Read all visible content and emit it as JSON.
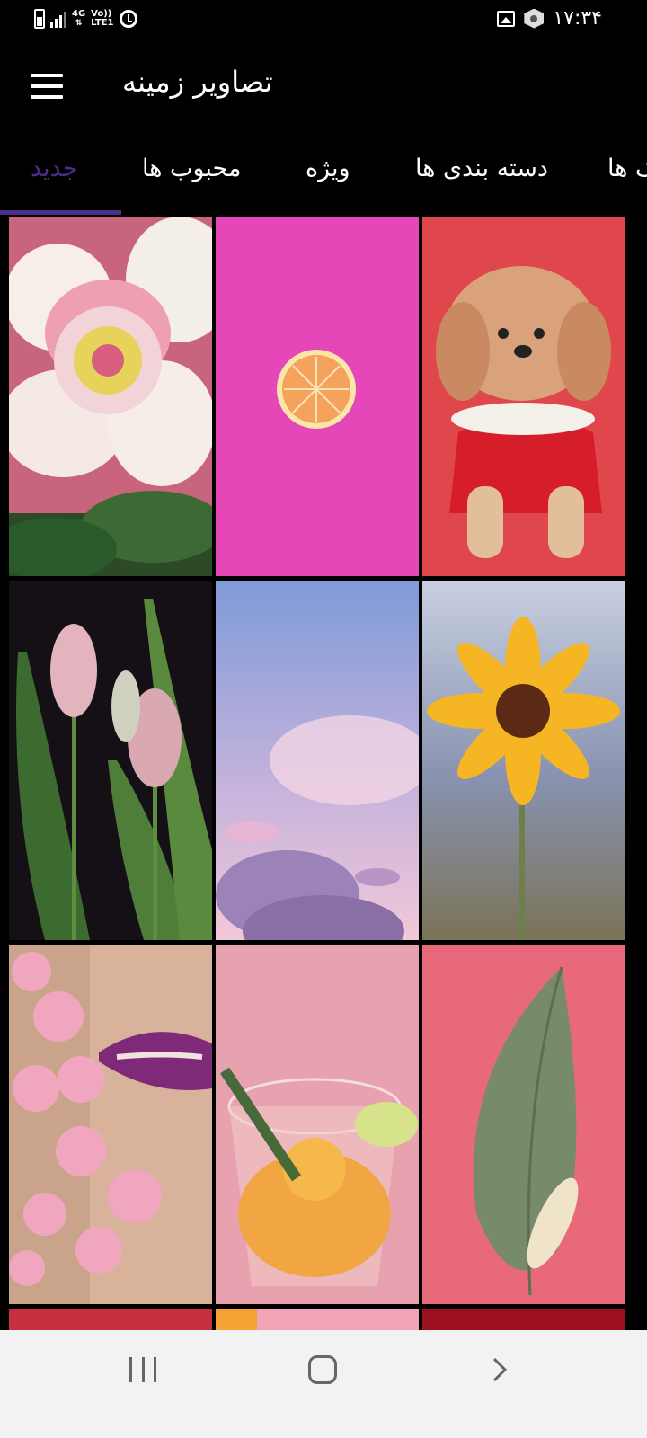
{
  "status_bar": {
    "network_4g": "4G",
    "network_volte": "Vo)) LTE1",
    "time": "۱۷:۳۴",
    "icons": [
      "battery-icon",
      "signal-icon",
      "alarm-icon",
      "image-icon",
      "vpn-hex-icon"
    ]
  },
  "app_bar": {
    "title": "تصاویر زمینه",
    "menu_icon": "hamburger-menu-icon"
  },
  "tabs": [
    {
      "label": "جدید",
      "active": true
    },
    {
      "label": "محبوب ها",
      "active": false
    },
    {
      "label": "ویژه",
      "active": false
    },
    {
      "label": "دسته بندی ها",
      "active": false
    },
    {
      "label": "ک ها",
      "active": false
    }
  ],
  "colors": {
    "accent": "#4a2e8a",
    "background": "#000000",
    "nav_bar": "#f2f2f2"
  },
  "grid": {
    "columns": 3,
    "tiles": [
      "pink-flower-wallpaper",
      "lemon-slice-on-pink-wallpaper",
      "dog-on-red-wallpaper",
      "tulips-wallpaper",
      "pink-sky-clouds-wallpaper",
      "sunflower-wallpaper",
      "lips-and-blossoms-wallpaper",
      "citrus-drink-wallpaper",
      "peace-lily-wallpaper",
      "partial-red-tile",
      "partial-orange-tile",
      "partial-crimson-tile"
    ]
  },
  "nav_bar": {
    "icons": [
      "recent-apps-icon",
      "home-icon",
      "back-icon"
    ]
  }
}
